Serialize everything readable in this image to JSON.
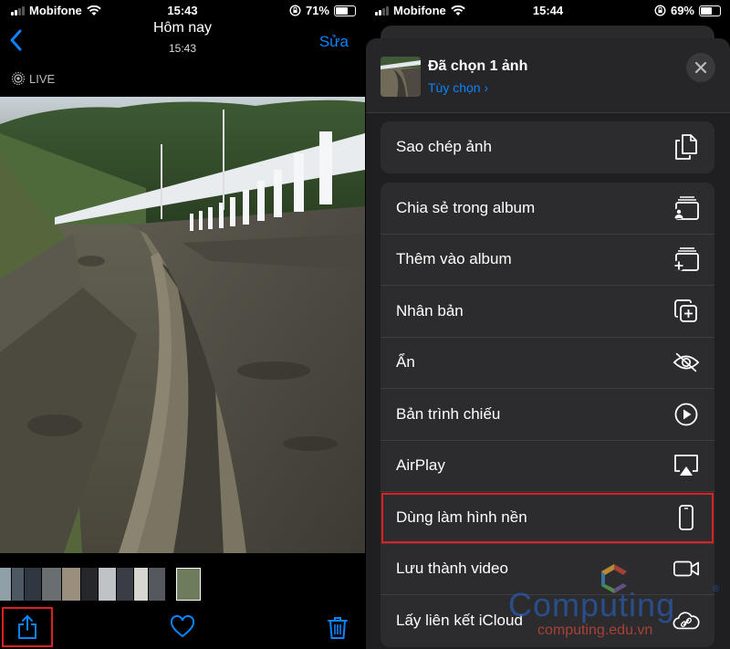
{
  "left_screen": {
    "status_bar": {
      "carrier": "Mobifone",
      "time": "15:43",
      "battery": "71%",
      "battery_level": 0.71
    },
    "nav": {
      "title": "Hôm nay",
      "subtitle": "15:43",
      "edit_label": "Sửa"
    },
    "live_label": "LIVE",
    "toolbar": {
      "share_icon": "share-icon",
      "heart_icon": "heart-icon",
      "trash_icon": "trash-icon"
    }
  },
  "right_screen": {
    "status_bar": {
      "carrier": "Mobifone",
      "time": "15:44",
      "battery": "69%",
      "battery_level": 0.69
    },
    "sheet": {
      "title": "Đã chọn 1 ảnh",
      "options_label": "Tùy chọn ›",
      "group1": [
        {
          "label": "Sao chép ảnh",
          "icon": "copy-icon"
        }
      ],
      "group2": [
        {
          "label": "Chia sẻ trong album",
          "icon": "shared-album-icon"
        },
        {
          "label": "Thêm vào album",
          "icon": "add-album-icon"
        },
        {
          "label": "Nhân bản",
          "icon": "duplicate-icon"
        },
        {
          "label": "Ẩn",
          "icon": "hide-eye-icon"
        },
        {
          "label": "Bản trình chiếu",
          "icon": "play-icon"
        },
        {
          "label": "AirPlay",
          "icon": "airplay-icon"
        },
        {
          "label": "Dùng làm hình nền",
          "icon": "phone-icon"
        },
        {
          "label": "Lưu thành video",
          "icon": "video-icon"
        },
        {
          "label": "Lấy liên kết iCloud",
          "icon": "icloud-link-icon"
        }
      ]
    },
    "watermark": {
      "name": "Computing",
      "url": "computing.edu.vn",
      "mark": "®"
    }
  },
  "colors": {
    "accent": "#0a84ff",
    "highlight": "#e02020",
    "sheet": "#2c2c2e"
  }
}
